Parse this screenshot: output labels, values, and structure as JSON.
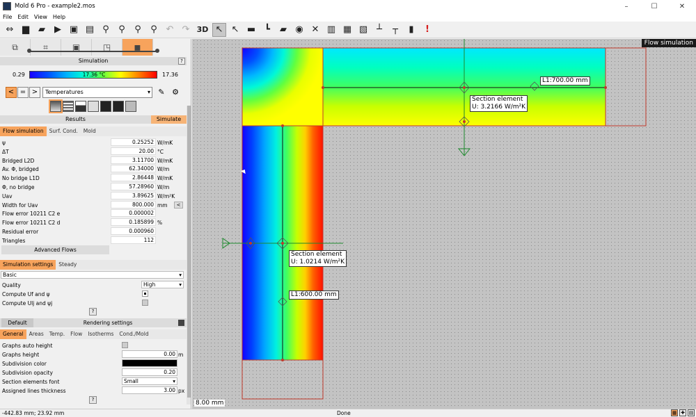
{
  "window": {
    "title": "Mold 6 Pro - example2.mos",
    "controls": [
      "–",
      "☐",
      "✕"
    ]
  },
  "menu": [
    "File",
    "Edit",
    "View",
    "Help"
  ],
  "toolbar": {
    "icons": [
      "move-arrows-icon",
      "new-file-icon",
      "open-folder-icon",
      "import-icon",
      "save-icon",
      "print-icon",
      "zoom-in-icon",
      "zoom-out-icon",
      "zoom-fit-icon",
      "zoom-window-icon",
      "undo-icon",
      "redo-icon"
    ],
    "view_3d_label": "3D",
    "tools": [
      "select-icon",
      "select-points-icon",
      "measure-icon",
      "dimension-icon",
      "comment-icon",
      "eye-icon",
      "hide-icon",
      "columns-icon",
      "bar-chart-icon",
      "line-chart-icon",
      "lt-icon",
      "ot-icon",
      "thermometer-icon",
      "warning-icon"
    ],
    "warning_glyph": "!"
  },
  "simulation": {
    "header": "Simulation",
    "help": "?",
    "scale_min": "0.29",
    "scale_max": "17.36",
    "scale_mid": "17.36 °C",
    "scale_colors": [
      "#1a00ff",
      "#00b0ff",
      "#60ff40",
      "#ffff00",
      "#ff0000"
    ],
    "nav": [
      "<",
      "=",
      ">"
    ],
    "view_select": "Temperatures"
  },
  "results": {
    "header": "Results",
    "simulate_label": "Simulate",
    "tabs": [
      "Flow simulation",
      "Surf. Cond.",
      "Mold"
    ],
    "rows": [
      {
        "label": "ψ",
        "value": "0.25252",
        "unit": "W/mK"
      },
      {
        "label": "ΔT",
        "value": "20.00",
        "unit": "°C"
      },
      {
        "label": "Bridged L2D",
        "value": "3.11700",
        "unit": "W/mK"
      },
      {
        "label": "Av. Φ, bridged",
        "value": "62.34000",
        "unit": "W/m"
      },
      {
        "label": "No bridge L1D",
        "value": "2.86448",
        "unit": "W/mK"
      },
      {
        "label": "Φ, no bridge",
        "value": "57.28960",
        "unit": "W/m"
      },
      {
        "label": "Uav",
        "value": "3.89625",
        "unit": "W/m²K"
      },
      {
        "label": "Width for Uav",
        "value": "800.000",
        "unit": "mm"
      },
      {
        "label": "Flow error 10211 C2 e",
        "value": "0.000002",
        "unit": ""
      },
      {
        "label": "Flow error 10211 C2 d",
        "value": "0.185899",
        "unit": "%"
      },
      {
        "label": "Residual error",
        "value": "0.000960",
        "unit": ""
      },
      {
        "label": "Triangles",
        "value": "112",
        "unit": ""
      }
    ],
    "width_btn": "<",
    "advanced_flows": "Advanced Flows"
  },
  "sim_settings": {
    "tabs": [
      "Simulation settings",
      "Steady"
    ],
    "preset": "Basic",
    "quality_label": "Quality",
    "quality_value": "High",
    "uf_label": "Compute Uf and ψ",
    "ulj_label": "Compute Ulj and ψj",
    "help": "?"
  },
  "rendering": {
    "default_label": "Default",
    "title": "Rendering settings",
    "tabs": [
      "General",
      "Areas",
      "Temp.",
      "Flow",
      "Isotherms",
      "Cond./Mold"
    ],
    "graphs_auto_label": "Graphs auto height",
    "graphs_height_label": "Graphs height",
    "graphs_height_value": "0.00",
    "graphs_height_unit": "m",
    "subdiv_color_label": "Subdivision color",
    "subdiv_color": "#000000",
    "subdiv_opacity_label": "Subdivision opacity",
    "subdiv_opacity_value": "0.20",
    "sec_font_label": "Section elements font",
    "sec_font_value": "Small",
    "assigned_label": "Assigned lines thickness",
    "assigned_value": "3.00",
    "assigned_unit": "px",
    "help": "?"
  },
  "canvas": {
    "title": "Flow simulation",
    "scale": "8.00 mm",
    "section1": {
      "title": "Section element",
      "u": "U: 3.2166 W/m²K"
    },
    "section2": {
      "title": "Section element",
      "u": "U: 1.0214 W/m²K"
    },
    "length1": "L1:700.00 mm",
    "length2": "L1:600.00 mm"
  },
  "status": {
    "coords": "-442.83 mm; 23.92 mm",
    "text": "Done"
  }
}
